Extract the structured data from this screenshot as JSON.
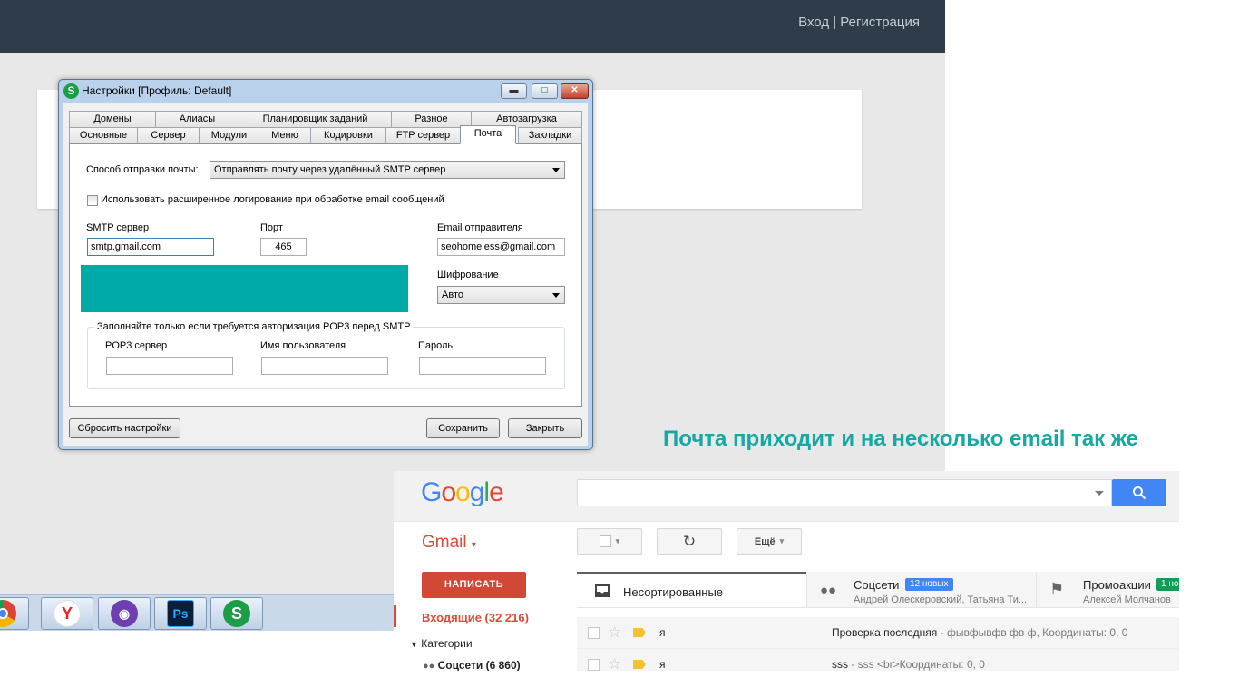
{
  "site": {
    "auth_text": "Вход | Регистрация"
  },
  "taskbar": {
    "apps": [
      "chrome-icon",
      "yandex-icon",
      "github-icon",
      "photoshop-icon",
      "seo-app-icon"
    ],
    "yandex_letter": "Y",
    "ps_letter": "Ps",
    "seo_letter": "S"
  },
  "dialog": {
    "title": "Настройки [Профиль: Default]",
    "app_icon_letter": "S",
    "tabs_row1": [
      "Домены",
      "Алиасы",
      "Планировщик заданий",
      "Разное",
      "Автозагрузка"
    ],
    "tabs_row2": [
      "Основные",
      "Сервер",
      "Модули",
      "Меню",
      "Кодировки",
      "FTP сервер",
      "Почта",
      "Закладки"
    ],
    "active_tab": "Почта",
    "send_method_label": "Способ отправки почты:",
    "send_method_value": "Отправлять почту через удалённый SMTP сервер",
    "logging_label": "Использовать расширенное логирование при обработке email сообщений",
    "smtp_label": "SMTP сервер",
    "smtp_value": "smtp.gmail.com",
    "port_label": "Порт",
    "port_value": "465",
    "sender_label": "Email отправителя",
    "sender_value": "seohomeless@gmail.com",
    "encryption_label": "Шифрование",
    "encryption_value": "Авто",
    "pop3_group_title": "Заполняйте только если требуется авторизация POP3 перед SMTP",
    "pop3_server_label": "POP3 сервер",
    "username_label": "Имя пользователя",
    "password_label": "Пароль",
    "reset_button": "Сбросить настройки",
    "save_button": "Сохранить",
    "close_button": "Закрыть"
  },
  "caption": "Почта приходит и на несколько email так же",
  "gmail": {
    "logo_letters": [
      "G",
      "o",
      "o",
      "g",
      "l",
      "e"
    ],
    "logo_colors": [
      "#4285f4",
      "#ea4335",
      "#fbbc05",
      "#4285f4",
      "#34a853",
      "#ea4335"
    ],
    "label": "Gmail",
    "more_button": "Ещё",
    "compose": "НАПИСАТЬ",
    "inbox": "Входящие (32 216)",
    "categories": "Категории",
    "social_folder": "Соцсети (6 860)",
    "tabs": [
      {
        "title": "Несортированные",
        "subtitle": "",
        "badge": ""
      },
      {
        "title": "Соцсети",
        "subtitle": "Андрей Олескеровский, Татьяна Ти...",
        "badge": "12 новых"
      },
      {
        "title": "Промоакции",
        "subtitle": "Алексей Молчанов",
        "badge": "1 но"
      }
    ],
    "emails": [
      {
        "from": "я",
        "subject": "Проверка последняя",
        "snippet": " - фывфывфв фв ф, Координаты: 0, 0"
      },
      {
        "from": "я",
        "subject": "sss",
        "snippet": " - sss <br>Координаты: 0, 0"
      }
    ]
  }
}
